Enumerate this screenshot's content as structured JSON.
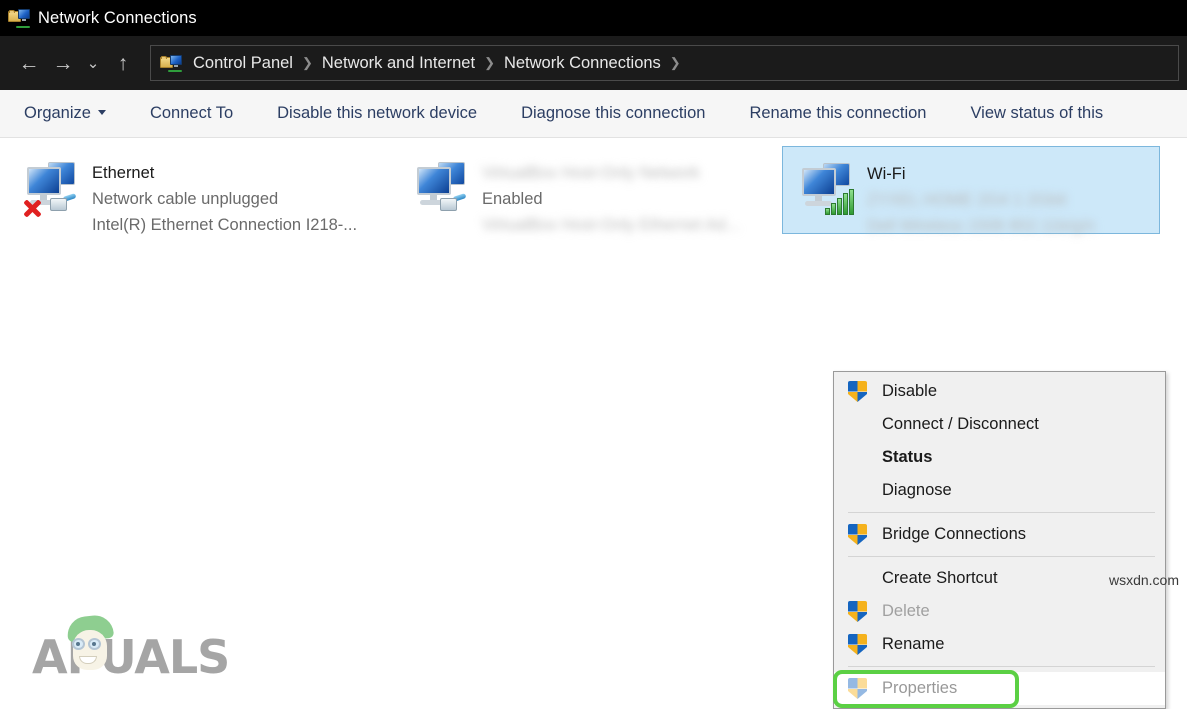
{
  "window": {
    "title": "Network Connections",
    "icon": "network-folder-icon"
  },
  "addressbar": {
    "back_icon": "←",
    "forward_icon": "→",
    "recent_icon": "⌄",
    "up_icon": "↑",
    "path_icon": "network-folder-icon",
    "crumbs": [
      {
        "label": "Control Panel"
      },
      {
        "label": "Network and Internet"
      },
      {
        "label": "Network Connections"
      }
    ],
    "separator": "❯"
  },
  "commandbar": {
    "items": [
      {
        "label": "Organize",
        "has_caret": true
      },
      {
        "label": "Connect To",
        "has_caret": false
      },
      {
        "label": "Disable this network device",
        "has_caret": false
      },
      {
        "label": "Diagnose this connection",
        "has_caret": false
      },
      {
        "label": "Rename this connection",
        "has_caret": false
      },
      {
        "label": "View status of this",
        "has_caret": false
      }
    ]
  },
  "connections": [
    {
      "name": "Ethernet",
      "status": "Network cable unplugged",
      "adapter": "Intel(R) Ethernet Connection I218-...",
      "icon": "network-adapter-disconnected-icon",
      "selected": false,
      "name_blurred": false,
      "status_blurred": false,
      "adapter_blurred": false
    },
    {
      "name": "VirtualBox Host-Only Network",
      "status": "Enabled",
      "adapter": "VirtualBox Host-Only Ethernet Ad...",
      "icon": "network-adapter-icon",
      "selected": false,
      "name_blurred": true,
      "status_blurred": false,
      "adapter_blurred": true
    },
    {
      "name": "Wi-Fi",
      "status": "ZYXEL HOME 2G4 1 2Gbit",
      "adapter": "Dell Wireless 1506 802.11b/g/n",
      "icon": "wifi-adapter-icon",
      "selected": true,
      "name_blurred": false,
      "status_blurred": true,
      "adapter_blurred": true
    }
  ],
  "context_menu": {
    "items": [
      {
        "label": "Disable",
        "shield": true,
        "bold": false,
        "disabled": false,
        "separator_after": false,
        "highlighted": false
      },
      {
        "label": "Connect / Disconnect",
        "shield": false,
        "bold": false,
        "disabled": false,
        "separator_after": false,
        "highlighted": false
      },
      {
        "label": "Status",
        "shield": false,
        "bold": true,
        "disabled": false,
        "separator_after": false,
        "highlighted": false
      },
      {
        "label": "Diagnose",
        "shield": false,
        "bold": false,
        "disabled": false,
        "separator_after": true,
        "highlighted": false
      },
      {
        "label": "Bridge Connections",
        "shield": true,
        "bold": false,
        "disabled": false,
        "separator_after": true,
        "highlighted": false
      },
      {
        "label": "Create Shortcut",
        "shield": false,
        "bold": false,
        "disabled": false,
        "separator_after": false,
        "highlighted": false
      },
      {
        "label": "Delete",
        "shield": true,
        "bold": false,
        "disabled": true,
        "separator_after": false,
        "highlighted": false
      },
      {
        "label": "Rename",
        "shield": true,
        "bold": false,
        "disabled": false,
        "separator_after": true,
        "highlighted": false
      },
      {
        "label": "Properties",
        "shield": true,
        "bold": false,
        "disabled": false,
        "separator_after": false,
        "highlighted": true
      }
    ]
  },
  "annotations": {
    "highlight_color": "#5bd044",
    "highlight_target": "Properties"
  },
  "watermarks": {
    "brand": "APPUALS",
    "brand_prefix": "A",
    "brand_suffix": "PUALS",
    "source": "wsxdn.com"
  },
  "colors": {
    "titlebar_bg": "#000000",
    "addressbar_bg": "#1b1b1b",
    "commandbar_bg": "#f6f6f6",
    "command_text": "#2c3e63",
    "selection_bg": "#cde8f9",
    "selection_border": "#7cb7dd",
    "menu_bg": "#f0f0f0",
    "shield_blue": "#1565c0",
    "shield_gold": "#f5b21c"
  }
}
